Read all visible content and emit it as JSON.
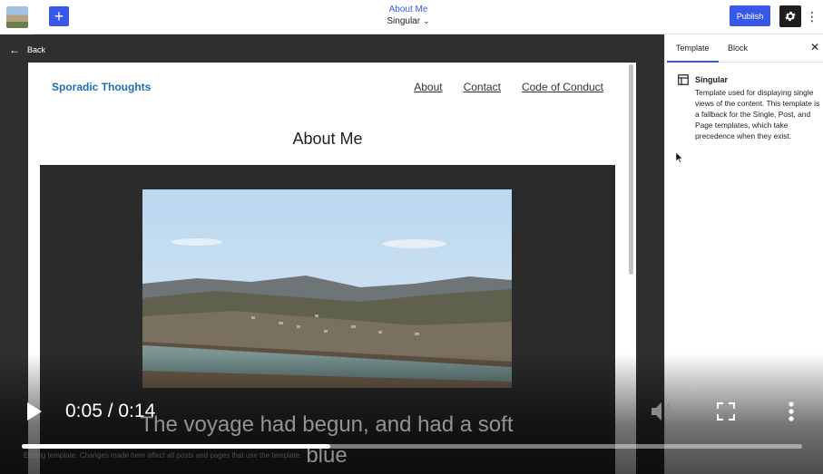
{
  "topbar": {
    "doc_title": "About Me",
    "doc_subtitle": "Singular",
    "publish_label": "Publish",
    "add_label": "+"
  },
  "canvas": {
    "back_label": "Back",
    "site_title": "Sporadic Thoughts",
    "nav": [
      "About",
      "Contact",
      "Code of Conduct"
    ],
    "page_heading": "About Me"
  },
  "sidebar": {
    "tabs": [
      "Template",
      "Block"
    ],
    "active_tab": "Template",
    "template_name": "Singular",
    "template_description": "Template used for displaying single views of the content. This template is a fallback for the Single, Post, and Page templates, which take precedence when they exist."
  },
  "video_player": {
    "current_time": "0:05",
    "duration": "0:14",
    "time_display": "0:05 / 0:14",
    "caption": "The voyage had begun, and had a soft blue",
    "progress": 0.395
  },
  "footer_note": "Editing template. Changes made here affect all posts and pages that use the template.",
  "colors": {
    "accent": "#3858e9",
    "site_title": "#1f6fb5",
    "canvas_bg": "#2f2f2f"
  }
}
